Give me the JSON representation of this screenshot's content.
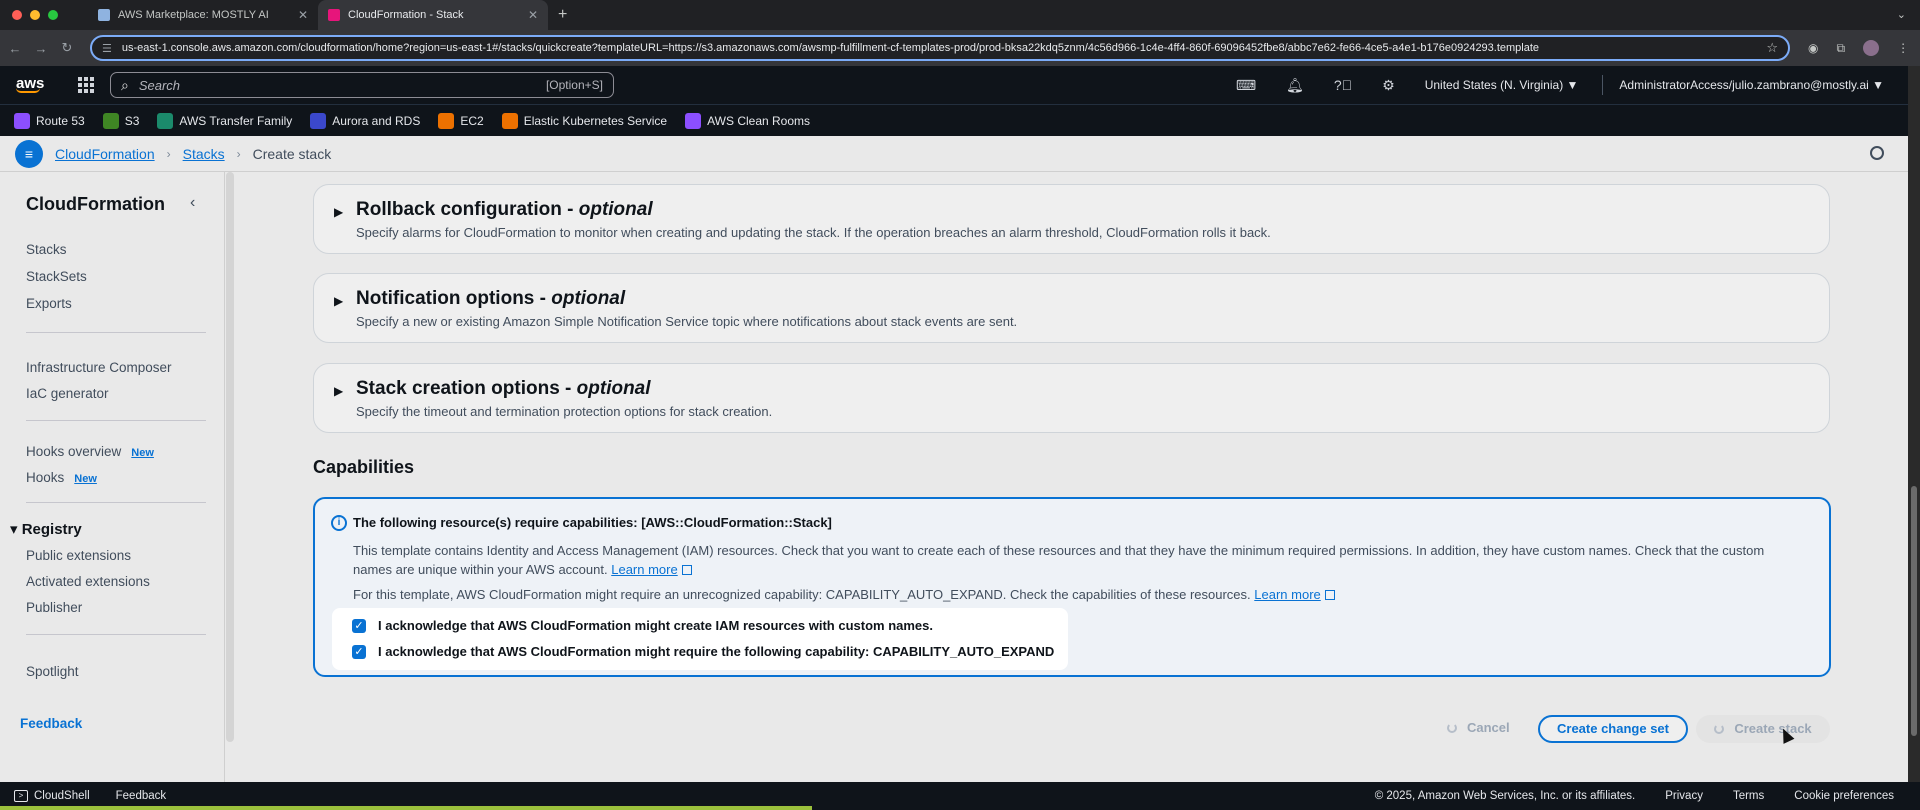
{
  "browser": {
    "tabs": [
      {
        "label": "AWS Marketplace: MOSTLY AI",
        "active": false
      },
      {
        "label": "CloudFormation - Stack",
        "active": true
      }
    ],
    "url": "us-east-1.console.aws.amazon.com/cloudformation/home?region=us-east-1#/stacks/quickcreate?templateURL=https://s3.amazonaws.com/awsmp-fulfillment-cf-templates-prod/prod-bksa22kdq5znm/4c56d966-1c4e-4ff4-860f-69096452fbe8/abbc7e62-fe66-4ce5-a4e1-b176e0924293.template"
  },
  "awsnav": {
    "search_placeholder": "Search",
    "search_shortcut": "[Option+S]",
    "region": "United States (N. Virginia) ▼",
    "account": "AdministratorAccess/julio.zambrano@mostly.ai ▼"
  },
  "favorites": [
    {
      "label": "Route 53",
      "color": "#8c4fff"
    },
    {
      "label": "S3",
      "color": "#3f8624"
    },
    {
      "label": "AWS Transfer Family",
      "color": "#1b8a6b"
    },
    {
      "label": "Aurora and RDS",
      "color": "#3b48cc"
    },
    {
      "label": "EC2",
      "color": "#ed7100"
    },
    {
      "label": "Elastic Kubernetes Service",
      "color": "#ed7100"
    },
    {
      "label": "AWS Clean Rooms",
      "color": "#8c4fff"
    }
  ],
  "breadcrumb": {
    "items": [
      "CloudFormation",
      "Stacks",
      "Create stack"
    ]
  },
  "sidebar": {
    "title": "CloudFormation",
    "group1": [
      "Stacks",
      "StackSets",
      "Exports"
    ],
    "group2": [
      "Infrastructure Composer",
      "IaC generator"
    ],
    "hooks_overview": "Hooks overview",
    "hooks": "Hooks",
    "new_badge": "New",
    "registry": "Registry",
    "registry_items": [
      "Public extensions",
      "Activated extensions",
      "Publisher"
    ],
    "spotlight": "Spotlight",
    "feedback": "Feedback"
  },
  "panels": [
    {
      "title": "Rollback configuration - ",
      "optional": "optional",
      "desc": "Specify alarms for CloudFormation to monitor when creating and updating the stack. If the operation breaches an alarm threshold, CloudFormation rolls it back."
    },
    {
      "title": "Notification options - ",
      "optional": "optional",
      "desc": "Specify a new or existing Amazon Simple Notification Service topic where notifications about stack events are sent."
    },
    {
      "title": "Stack creation options - ",
      "optional": "optional",
      "desc": "Specify the timeout and termination protection options for stack creation."
    }
  ],
  "capabilities": {
    "heading": "Capabilities",
    "info_title": "The following resource(s) require capabilities: [AWS::CloudFormation::Stack]",
    "info_body": "This template contains Identity and Access Management (IAM) resources. Check that you want to create each of these resources and that they have the minimum required permissions. In addition, they have custom names. Check that the custom names are unique within your AWS account.",
    "info_body2": "For this template, AWS CloudFormation might require an unrecognized capability: CAPABILITY_AUTO_EXPAND. Check the capabilities of these resources.",
    "learn_more": "Learn more",
    "ack1": "I acknowledge that AWS CloudFormation might create IAM resources with custom names.",
    "ack2": "I acknowledge that AWS CloudFormation might require the following capability: CAPABILITY_AUTO_EXPAND",
    "ack1_checked": true,
    "ack2_checked": true
  },
  "actions": {
    "cancel": "Cancel",
    "create_change_set": "Create change set",
    "create_stack": "Create stack"
  },
  "footer": {
    "cloudshell": "CloudShell",
    "feedback": "Feedback",
    "copyright": "© 2025, Amazon Web Services, Inc. or its affiliates.",
    "privacy": "Privacy",
    "terms": "Terms",
    "cookies": "Cookie preferences"
  },
  "colors": {
    "link": "#0972d3",
    "nav_bg": "#0f141a",
    "accent_orange": "#ff9900"
  }
}
